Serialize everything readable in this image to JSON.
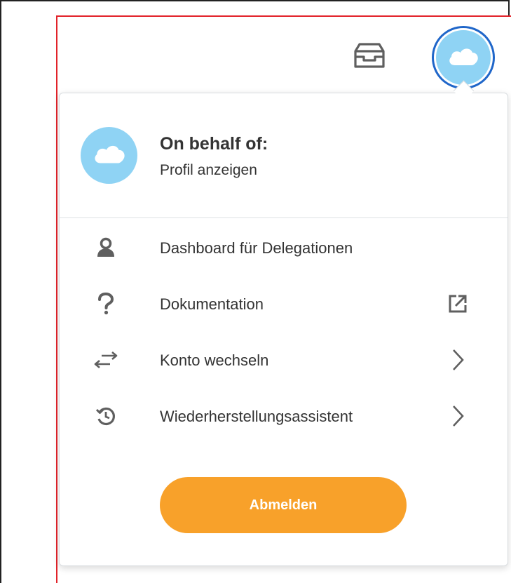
{
  "header": {
    "inbox_icon": "inbox-tray-icon",
    "avatar_icon": "cloud-icon",
    "avatar_ring_color": "#1f66c9",
    "avatar_fill_color": "#8fd3f4"
  },
  "profile": {
    "title": "On behalf of:",
    "link_label": "Profil anzeigen",
    "avatar_icon": "cloud-icon"
  },
  "menu": {
    "items": [
      {
        "label": "Dashboard für Delegationen",
        "icon": "person-icon",
        "trailing": ""
      },
      {
        "label": "Dokumentation",
        "icon": "question-mark-icon",
        "trailing": "external-link-icon"
      },
      {
        "label": "Konto wechseln",
        "icon": "swap-arrows-icon",
        "trailing": "chevron-right-icon"
      },
      {
        "label": "Wiederherstellungsassistent",
        "icon": "history-icon",
        "trailing": "chevron-right-icon"
      }
    ]
  },
  "logout": {
    "label": "Abmelden",
    "color": "#f8a12a"
  }
}
